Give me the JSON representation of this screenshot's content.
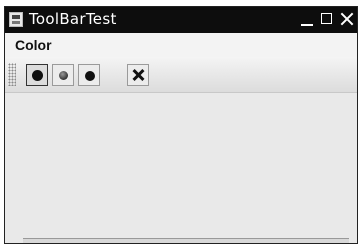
{
  "window": {
    "title": "ToolBarTest"
  },
  "menubar": {
    "items": [
      {
        "label": "Color"
      }
    ]
  },
  "toolbar": {
    "buttons": [
      {
        "icon": "black-circle-icon",
        "state": "pressed"
      },
      {
        "icon": "gray-sphere-icon"
      },
      {
        "icon": "black-dot-icon"
      },
      {
        "icon": "close-x-icon"
      }
    ]
  },
  "colors": {
    "titlebar": "#0d0d0d",
    "panel": "#e9e9e9"
  }
}
